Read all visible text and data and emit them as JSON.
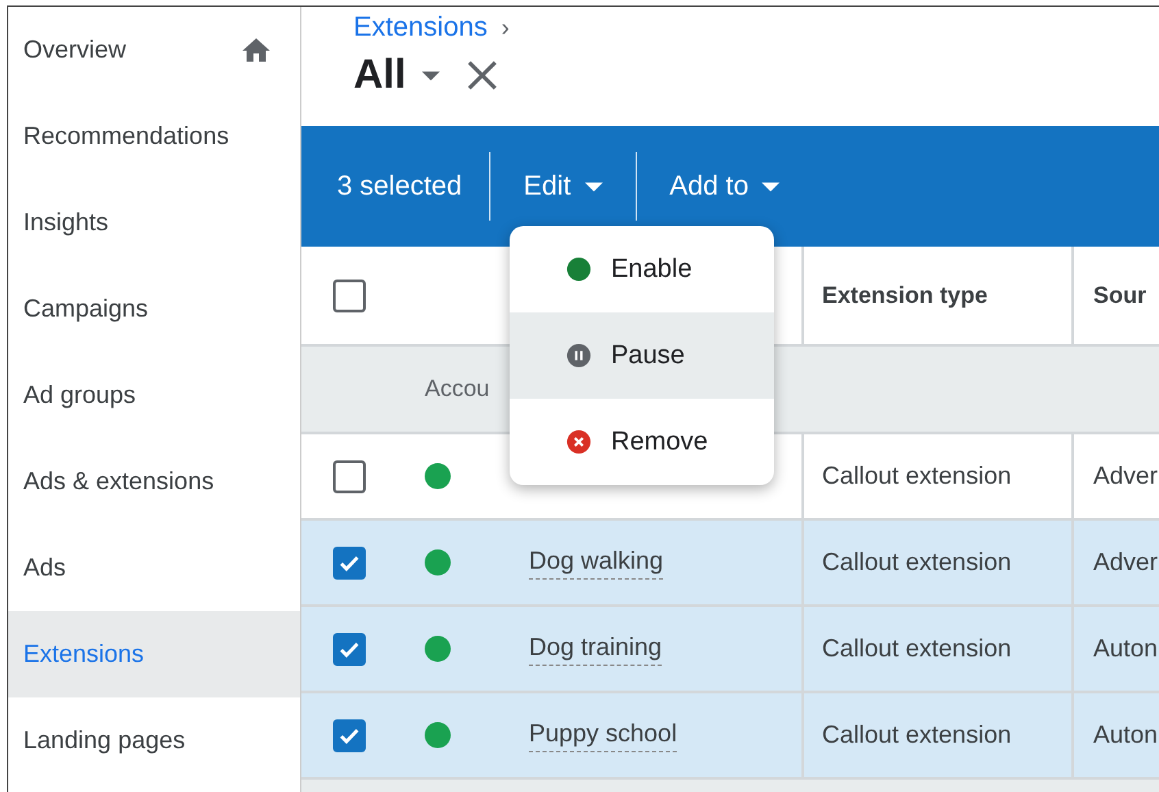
{
  "sidebar": {
    "items": [
      {
        "label": "Overview",
        "selected": false,
        "home_icon": true
      },
      {
        "label": "Recommendations",
        "selected": false
      },
      {
        "label": "Insights",
        "selected": false
      },
      {
        "label": "Campaigns",
        "selected": false
      },
      {
        "label": "Ad groups",
        "selected": false
      },
      {
        "label": "Ads & extensions",
        "selected": false
      },
      {
        "label": "Ads",
        "selected": false
      },
      {
        "label": "Extensions",
        "selected": true
      },
      {
        "label": "Landing pages",
        "selected": false
      }
    ]
  },
  "breadcrumb": "Extensions",
  "breadcrumb_separator": "›",
  "view": {
    "title": "All"
  },
  "action_bar": {
    "count": "3 selected",
    "actions": [
      "Edit",
      "Add to"
    ]
  },
  "menu": [
    {
      "label": "Enable",
      "kind": "enable",
      "highlighted": false
    },
    {
      "label": "Pause",
      "kind": "pause",
      "highlighted": true
    },
    {
      "label": "Remove",
      "kind": "remove",
      "highlighted": false
    }
  ],
  "table": {
    "select_all_checked": false,
    "columns": [
      "Extension type",
      "Sour"
    ],
    "group_row": "Accou",
    "rows": [
      {
        "checked": false,
        "enabled": true,
        "type": "Callout extension",
        "column_5": "Adver"
      },
      {
        "checked": true,
        "enabled": true,
        "name": "Dog walking",
        "type": "Callout extension",
        "column_5": "Adver"
      },
      {
        "checked": true,
        "enabled": true,
        "name": "Dog training",
        "type": "Callout extension",
        "column_5": "Auton"
      },
      {
        "checked": true,
        "enabled": true,
        "name": "Puppy school",
        "type": "Callout extension",
        "column_5": "Auton"
      }
    ]
  }
}
